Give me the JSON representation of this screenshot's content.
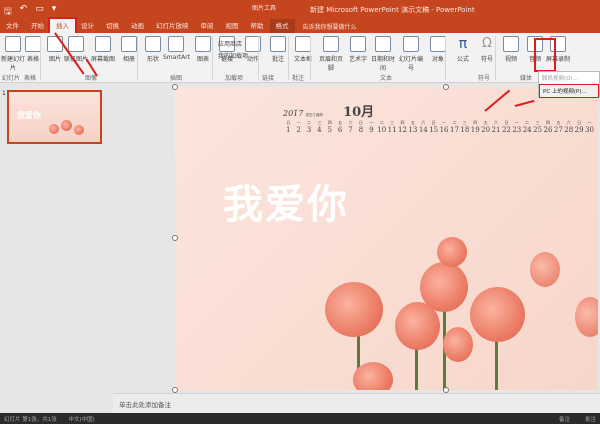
{
  "window": {
    "title": "新建 Microsoft PowerPoint 演示文稿 - PowerPoint",
    "tool_context": "图片工具",
    "tell_me": "告诉我你想要做什么"
  },
  "qat": {
    "save": "🖫",
    "undo": "↶",
    "start": "▭",
    "more": "▾"
  },
  "tabs": [
    "文件",
    "开始",
    "插入",
    "设计",
    "切换",
    "动画",
    "幻灯片放映",
    "审阅",
    "视图",
    "帮助",
    "格式"
  ],
  "ribbon": {
    "buttons": [
      {
        "label": "新建幻灯片"
      },
      {
        "label": "表格"
      },
      {
        "label": "图片"
      },
      {
        "label": "联机图片"
      },
      {
        "label": "屏幕截图"
      },
      {
        "label": "相册"
      },
      {
        "label": "形状"
      },
      {
        "label": "SmartArt"
      },
      {
        "label": "图表"
      },
      {
        "label": "链接"
      },
      {
        "label": "动作"
      },
      {
        "label": "批注"
      },
      {
        "label": "文本框"
      },
      {
        "label": "页眉和页脚"
      },
      {
        "label": "艺术字"
      },
      {
        "label": "日期和时间"
      },
      {
        "label": "幻灯片编号"
      },
      {
        "label": "对象"
      },
      {
        "label": "公式"
      },
      {
        "label": "符号"
      },
      {
        "label": "视频"
      },
      {
        "label": "音频"
      },
      {
        "label": "屏幕录制"
      }
    ],
    "addins": [
      "应用商店",
      "我的加载项"
    ],
    "groups": [
      "幻灯片",
      "表格",
      "图像",
      "插图",
      "加载项",
      "链接",
      "批注",
      "文本",
      "符号",
      "媒体"
    ]
  },
  "video_menu": [
    "联机视频(O)...",
    "PC 上的视频(P)..."
  ],
  "slide": {
    "number": "1",
    "year": "2017",
    "year_sub": "农历丁酉年",
    "month": "10月",
    "weekdays": [
      "日",
      "一",
      "二",
      "三",
      "四",
      "五",
      "六",
      "日",
      "一",
      "二",
      "三",
      "四",
      "五",
      "六",
      "日",
      "一",
      "二",
      "三",
      "四",
      "五",
      "六",
      "日",
      "一",
      "二",
      "三",
      "四",
      "五",
      "六",
      "日",
      "一"
    ],
    "days": [
      "1",
      "2",
      "3",
      "4",
      "5",
      "6",
      "7",
      "8",
      "9",
      "10",
      "11",
      "12",
      "13",
      "14",
      "15",
      "16",
      "17",
      "18",
      "19",
      "20",
      "21",
      "22",
      "23",
      "24",
      "25",
      "26",
      "27",
      "28",
      "29",
      "30"
    ],
    "headline": "我爱你"
  },
  "notes_placeholder": "单击此处添加备注",
  "status": {
    "slide_info": "幻灯片 第1张，共1张",
    "language": "中文(中国)",
    "notes": "备注",
    "comments": "批注"
  }
}
